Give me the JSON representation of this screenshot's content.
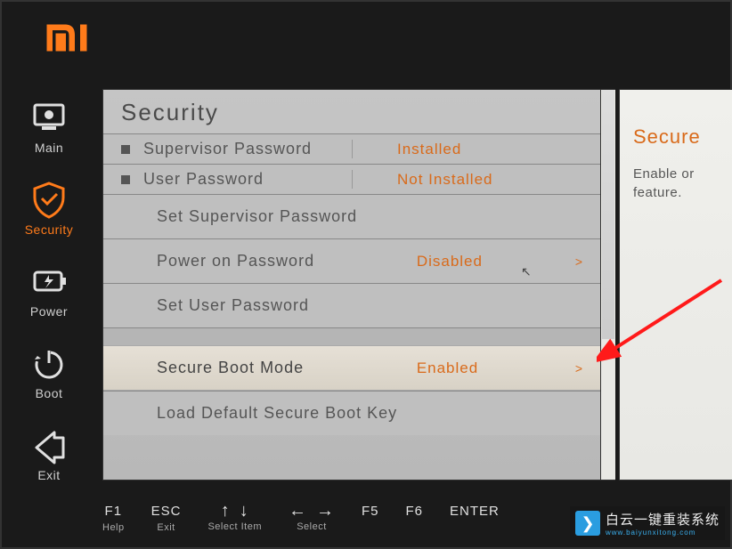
{
  "brand": "MI",
  "sidebar": {
    "items": [
      {
        "id": "main",
        "label": "Main"
      },
      {
        "id": "security",
        "label": "Security"
      },
      {
        "id": "power",
        "label": "Power"
      },
      {
        "id": "boot",
        "label": "Boot"
      },
      {
        "id": "exit",
        "label": "Exit"
      }
    ],
    "active": "security"
  },
  "page": {
    "title": "Security",
    "rows": [
      {
        "type": "info",
        "label": "Supervisor Password",
        "value": "Installed"
      },
      {
        "type": "info",
        "label": "User Password",
        "value": "Not Installed"
      },
      {
        "type": "action",
        "label": "Set Supervisor Password"
      },
      {
        "type": "select",
        "label": "Power on Password",
        "value": "Disabled",
        "arrow": ">"
      },
      {
        "type": "action",
        "label": "Set User Password"
      },
      {
        "type": "select",
        "label": "Secure Boot Mode",
        "value": "Enabled",
        "arrow": ">",
        "selected": true
      },
      {
        "type": "action",
        "label": "Load Default Secure Boot Key"
      }
    ]
  },
  "help": {
    "title": "Secure",
    "body": "Enable or\nfeature."
  },
  "footer": {
    "hints": [
      {
        "key": "F1",
        "label": "Help"
      },
      {
        "key": "ESC",
        "label": "Exit"
      },
      {
        "key": "↑ ↓",
        "label": "Select Item"
      },
      {
        "key": "← →",
        "label": "Select"
      },
      {
        "key": "F5",
        "label": ""
      },
      {
        "key": "F6",
        "label": ""
      },
      {
        "key": "ENTER",
        "label": ""
      }
    ]
  },
  "watermark": {
    "line1": "白云一键重装系统",
    "line2": "www.baiyunxitong.com"
  },
  "colors": {
    "accent": "#ff7b1a",
    "value": "#d96a1a",
    "panel": "#bfbfbf",
    "bg": "#1a1a1a"
  }
}
